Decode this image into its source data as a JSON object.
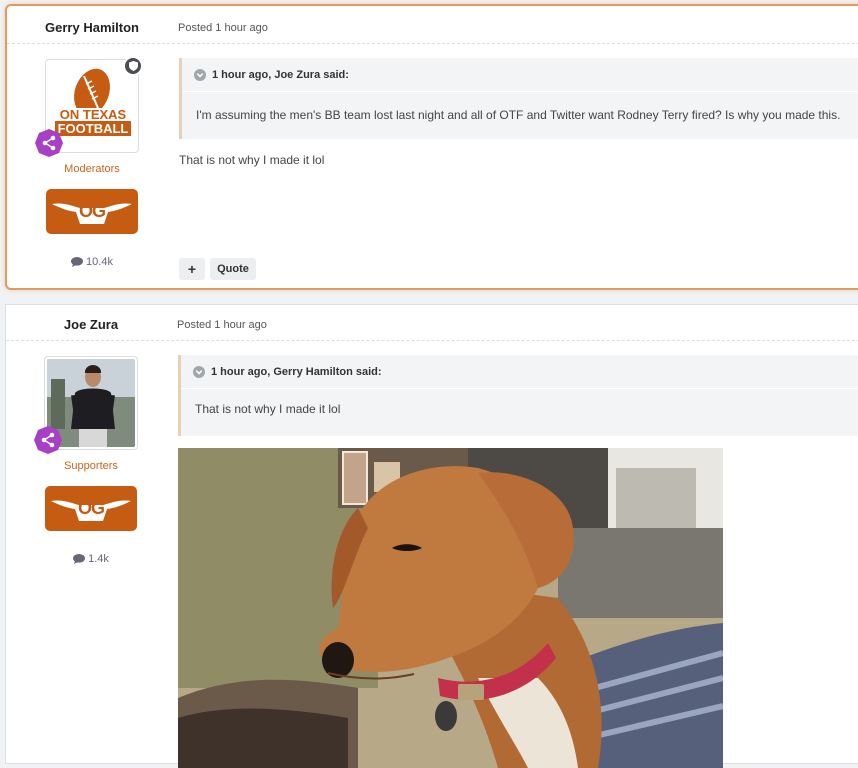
{
  "posts": [
    {
      "author": "Gerry Hamilton",
      "posted": "Posted 1 hour ago",
      "group": "Moderators",
      "badge_text": "OG",
      "post_count": "10.4k",
      "avatar_text_line1": "ON TEXAS",
      "avatar_text_line2": "FOOTBALL",
      "quote_citation": "1 hour ago, Joe Zura said:",
      "quote_text": "I'm assuming the men's BB team lost last night and all of OTF and Twitter want Rodney Terry fired? Is why you made this.",
      "body": "That is not why I made it lol",
      "actions": {
        "add": "+",
        "quote": "Quote"
      }
    },
    {
      "author": "Joe Zura",
      "posted": "Posted 1 hour ago",
      "group": "Supporters",
      "badge_text": "OG",
      "post_count": "1.4k",
      "quote_citation": "1 hour ago, Gerry Hamilton said:",
      "quote_text": "That is not why I made it lol"
    }
  ],
  "colors": {
    "accent": "#c65b12",
    "highlight_border": "#e39a5d",
    "rank_badge": "#a83fc7",
    "group_text": "#c9651b"
  },
  "icons": [
    "shield-icon",
    "rank-icon",
    "comment-icon",
    "chevron-icon"
  ]
}
